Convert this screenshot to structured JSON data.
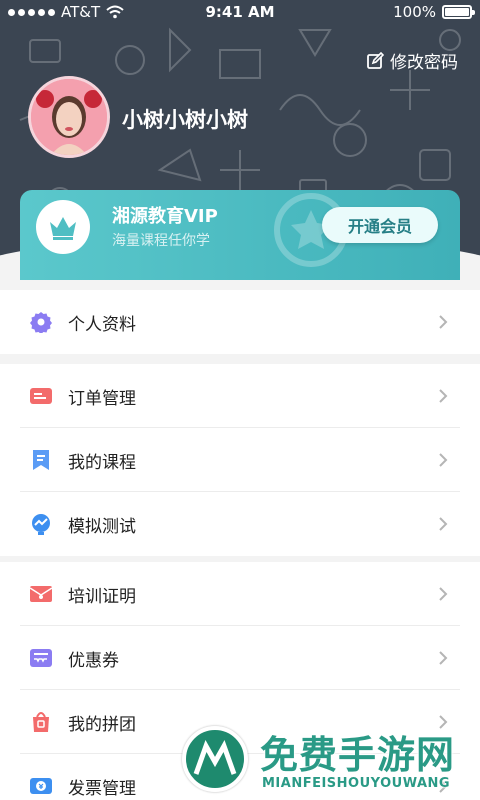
{
  "status_bar": {
    "carrier": "AT&T",
    "time": "9:41 AM",
    "battery": "100%"
  },
  "header": {
    "edit_password": "修改密码",
    "username": "小树小树小树"
  },
  "vip": {
    "title": "湘源教育VIP",
    "subtitle": "海量课程任你学",
    "button": "开通会员"
  },
  "menu": {
    "group1": [
      {
        "label": "个人资料",
        "icon": "gear-icon"
      }
    ],
    "group2": [
      {
        "label": "订单管理",
        "icon": "order-icon"
      },
      {
        "label": "我的课程",
        "icon": "bookmark-icon"
      },
      {
        "label": "模拟测试",
        "icon": "test-icon"
      }
    ],
    "group3": [
      {
        "label": "培训证明",
        "icon": "certificate-icon"
      },
      {
        "label": "优惠券",
        "icon": "coupon-icon"
      },
      {
        "label": "我的拼团",
        "icon": "group-buy-icon"
      },
      {
        "label": "发票管理",
        "icon": "invoice-icon"
      }
    ]
  },
  "watermark": {
    "main": "免费手游网",
    "sub": "MIANFEISHOUYOUWANG"
  },
  "colors": {
    "header_bg": "#3b4552",
    "vip_teal": "#4fbec3",
    "page_bg": "#f3f3f3"
  }
}
